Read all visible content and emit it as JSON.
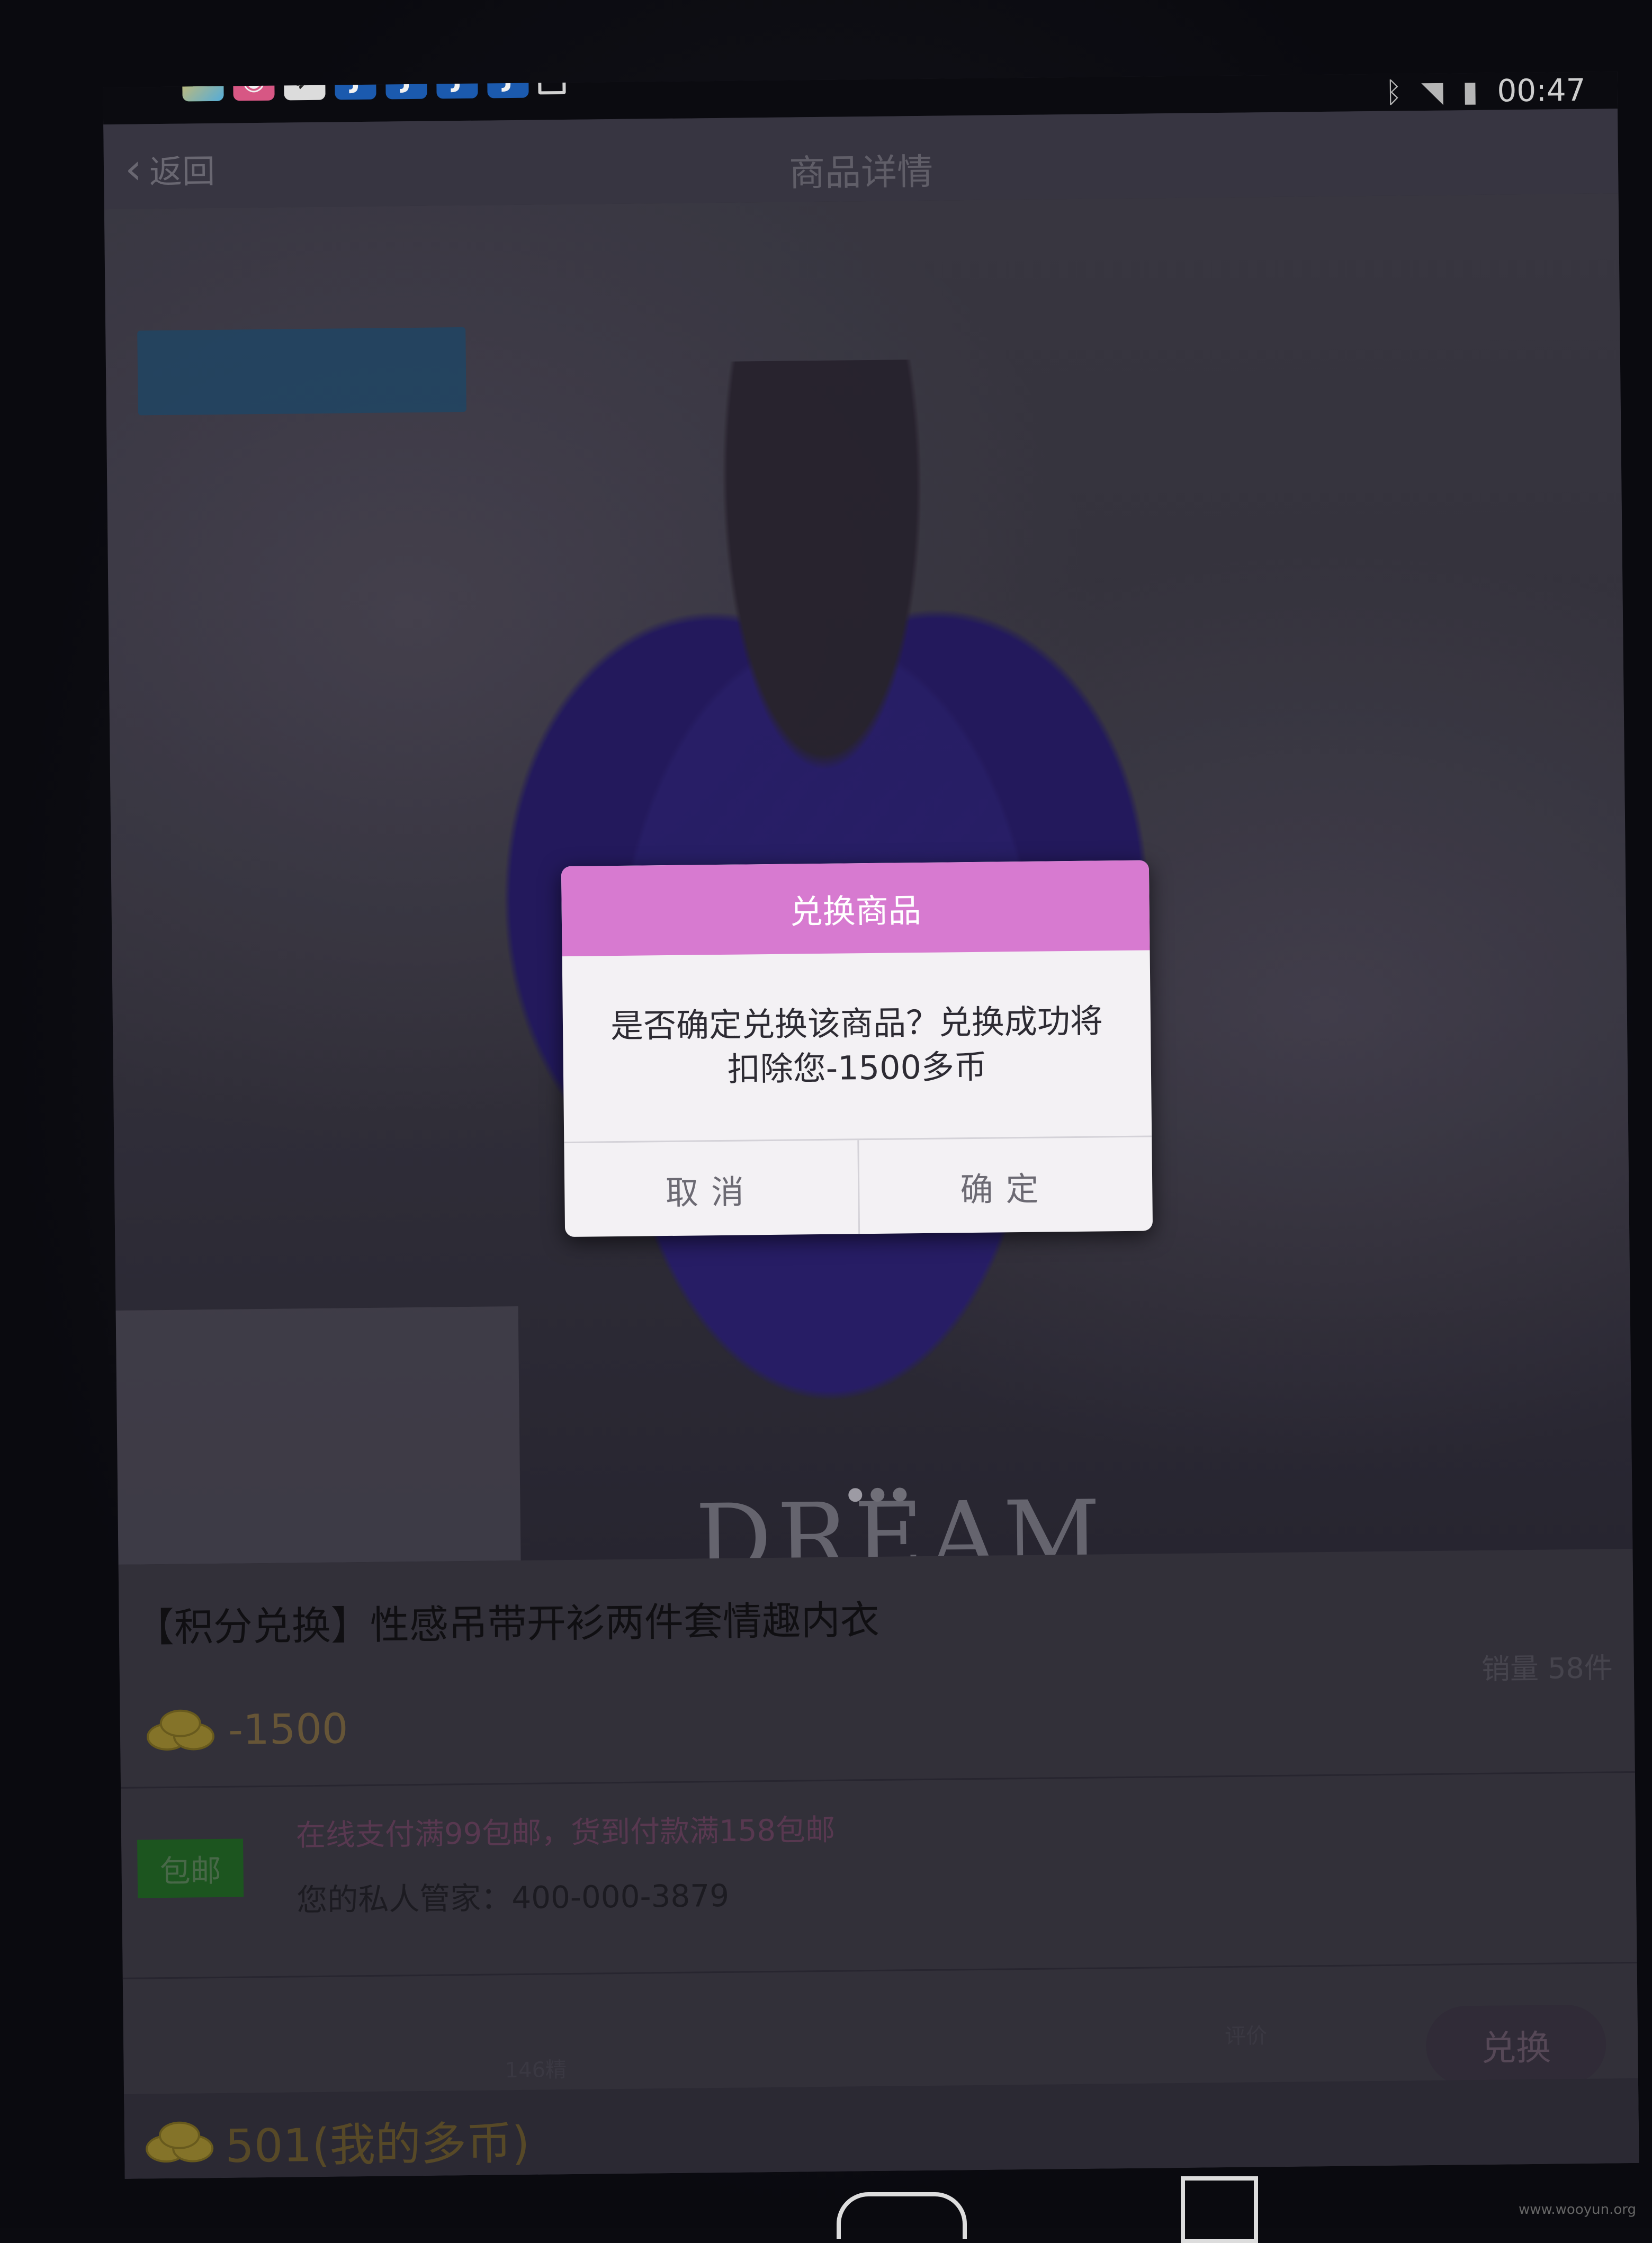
{
  "statusbar": {
    "notification_icons": [
      "game-icon",
      "gallery-icon",
      "pink-app-icon",
      "bird-icon",
      "j-app-icon",
      "j-app-icon",
      "j-app-icon",
      "j-app-icon",
      "download-icon"
    ],
    "j_letter": "J",
    "time": "00:47"
  },
  "nav": {
    "back_label": "返回",
    "title": "商品详情"
  },
  "image": {
    "brand_text": "DREAM",
    "page_dots": 3,
    "active_dot": 0
  },
  "product": {
    "title": "【积分兑换】性感吊带开衫两件套情趣内衣",
    "sales": "销量 58件",
    "price": "-1500",
    "free_shipping_badge": "包邮",
    "shipping_note": "在线支付满99包邮，货到付款满158包邮",
    "manager": "您的私人管家：400-000-3879",
    "faint_left": "146精",
    "faint_right": "评价"
  },
  "bottom": {
    "my_coins": "501(我的多币)",
    "exchange_button": "兑换"
  },
  "dialog": {
    "title": "兑换商品",
    "message_line1": "是否确定兑换该商品？兑换成功将",
    "message_line2": "扣除您-1500多币",
    "cancel": "取消",
    "confirm": "确定"
  },
  "watermark": "www.wooyun.org",
  "colors": {
    "dialog_header": "#d77ad0",
    "free_badge": "#1e5a21"
  }
}
